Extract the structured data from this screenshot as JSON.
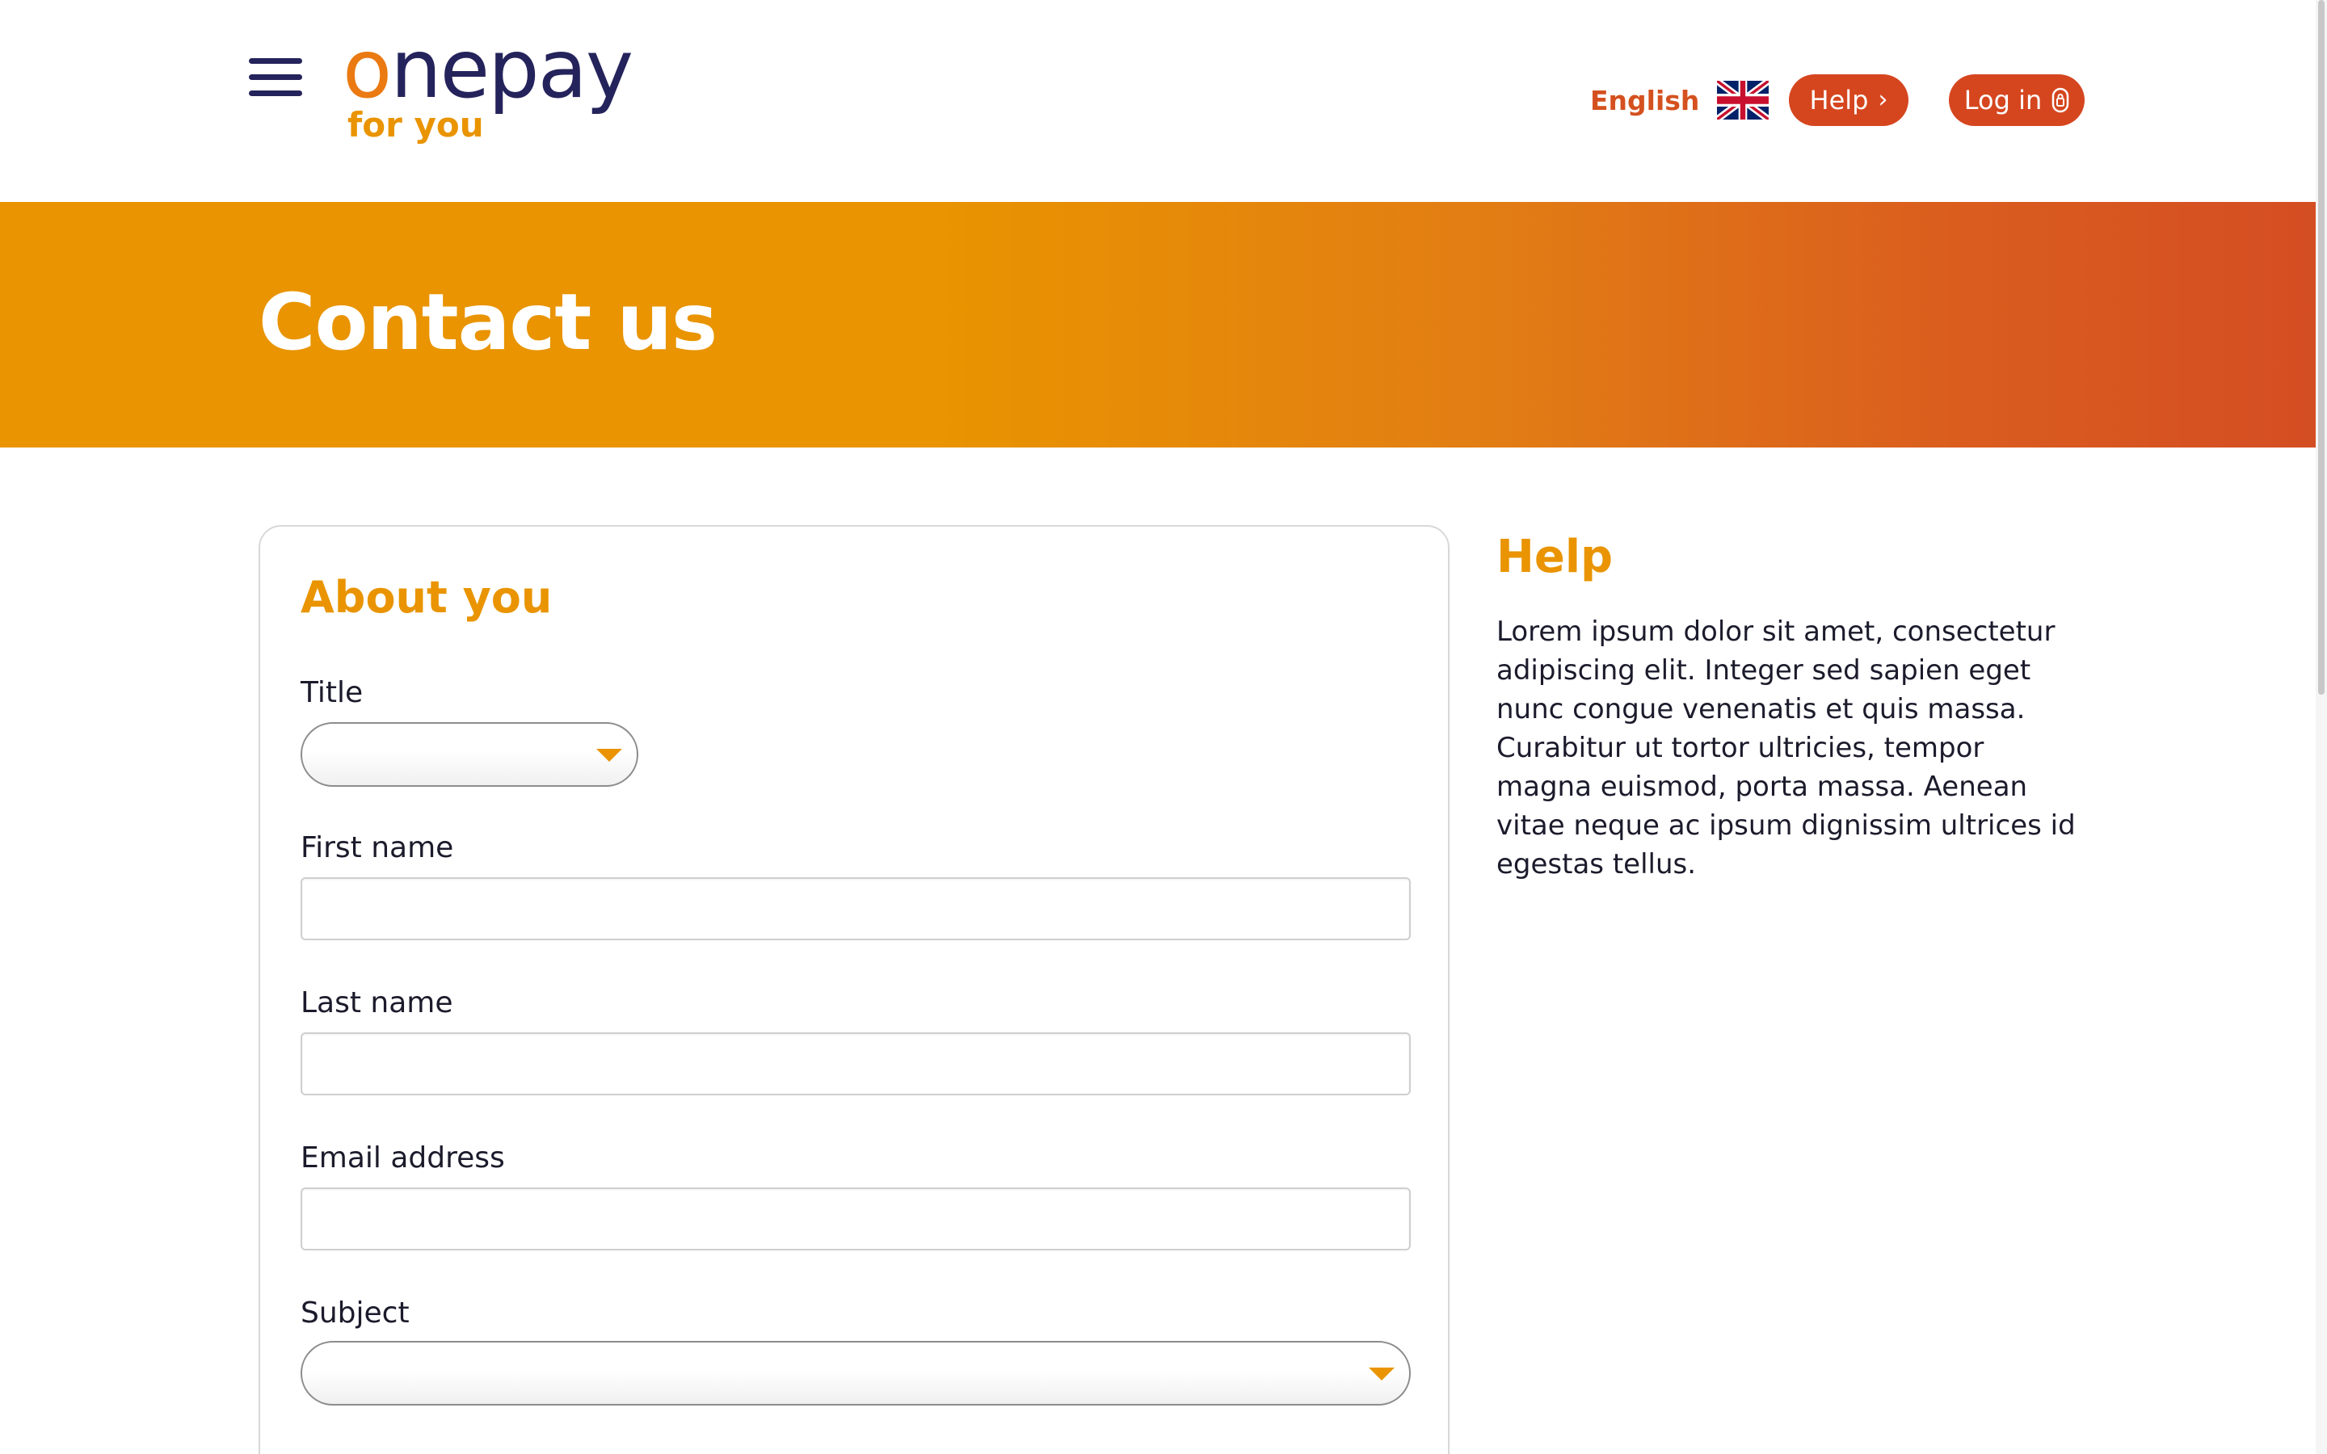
{
  "header": {
    "menu_icon": "hamburger-menu-icon",
    "logo": {
      "main": "onepay",
      "sub": "for you"
    },
    "language": {
      "label": "English",
      "flag_icon": "uk-flag-icon"
    },
    "help_button": {
      "label": "Help",
      "icon": "chevron-right-icon"
    },
    "login_button": {
      "label": "Log in",
      "icon": "lock-icon"
    }
  },
  "banner": {
    "title": "Contact us"
  },
  "form": {
    "section_title": "About you",
    "fields": {
      "title": {
        "label": "Title",
        "value": "",
        "icon": "caret-down-icon"
      },
      "first_name": {
        "label": "First name",
        "value": ""
      },
      "last_name": {
        "label": "Last name",
        "value": ""
      },
      "email": {
        "label": "Email address",
        "value": ""
      },
      "subject": {
        "label": "Subject",
        "value": "",
        "icon": "caret-down-icon"
      }
    }
  },
  "help_panel": {
    "title": "Help",
    "body": "Lorem ipsum dolor sit amet, consectetur adipiscing elit. Integer sed sapien eget nunc congue venenatis et quis massa. Curabitur ut tortor ultricies, tempor magna euismod, porta massa. Aenean vitae neque ac ipsum dignissim ultrices id egestas tellus."
  },
  "colors": {
    "brand_navy": "#25235b",
    "brand_orange": "#e99400",
    "accent_red": "#d5461f",
    "banner_start": "#e99400",
    "banner_end": "#d44d23"
  }
}
